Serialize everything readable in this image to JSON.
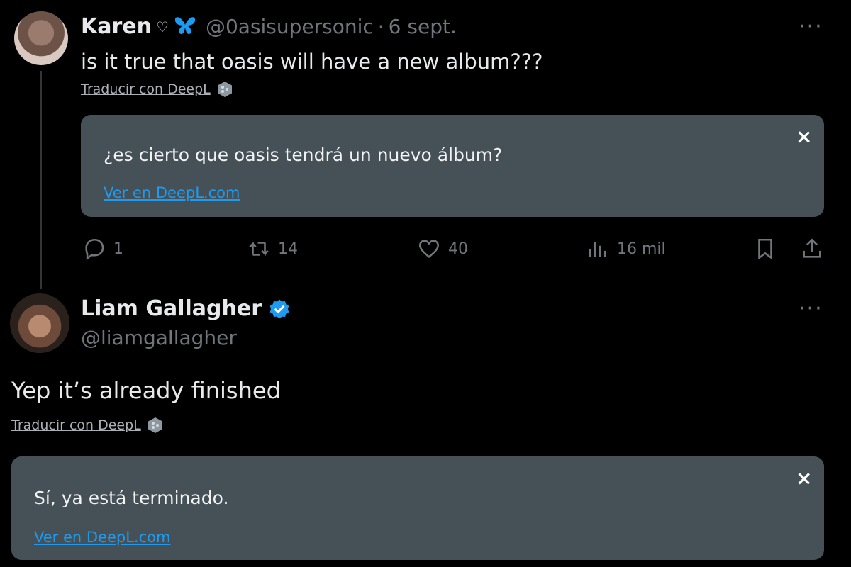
{
  "tweet1": {
    "name": "Karen",
    "handle": "@0asisupersonic",
    "separator": "·",
    "date": "6 sept.",
    "more": "···",
    "text": "is it true that oasis will have a new album???",
    "translate_label": "Traducir con DeepL",
    "translation": {
      "text": "¿es cierto que oasis tendrá un nuevo álbum?",
      "link": "Ver en DeepL.com",
      "close": "×"
    },
    "actions": {
      "replies": "1",
      "reposts": "14",
      "likes": "40",
      "views": "16 mil"
    }
  },
  "tweet2": {
    "name": "Liam Gallagher",
    "handle": "@liamgallagher",
    "more": "···",
    "text": "Yep it’s already finished",
    "translate_label": "Traducir con DeepL",
    "translation": {
      "text": "Sí, ya está terminado.",
      "link": "Ver en DeepL.com",
      "close": "×"
    }
  },
  "colors": {
    "background": "#000000",
    "card": "#465057",
    "link": "#1d9bf0",
    "muted": "#71767b",
    "verified": "#1d9bf0"
  }
}
